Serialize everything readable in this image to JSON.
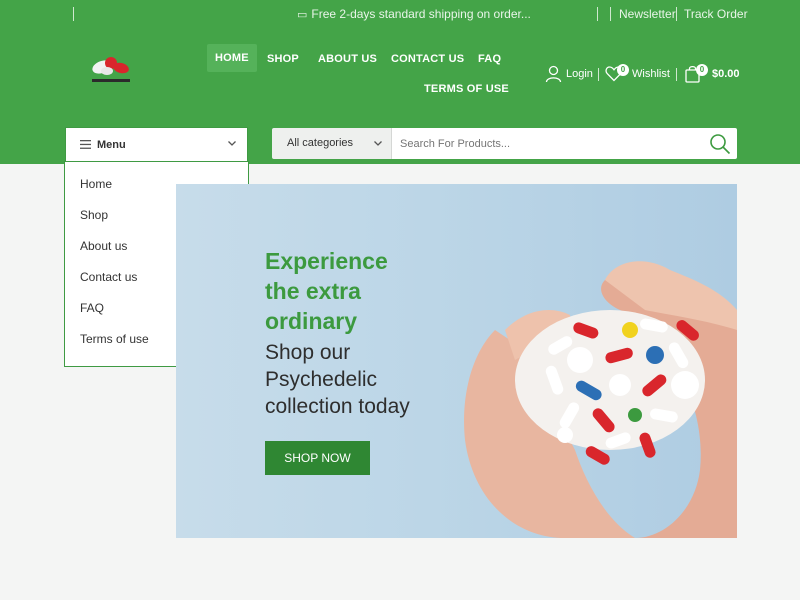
{
  "topbar": {
    "shipping_text": "Free 2-days standard shipping on order...",
    "newsletter": "Newsletter",
    "track_order": "Track Order"
  },
  "nav": {
    "home": "HOME",
    "shop": "SHOP",
    "about": "ABOUT US",
    "contact": "CONTACT US",
    "faq": "FAQ",
    "terms": "TERMS OF USE"
  },
  "header": {
    "login": "Login",
    "wishlist": "Wishlist",
    "wishlist_count": "0",
    "cart_count": "0",
    "cart_total": "$0.00",
    "logo_text": "Psychedelic"
  },
  "menu": {
    "label": "Menu",
    "items": [
      "Home",
      "Shop",
      "About us",
      "Contact us",
      "FAQ",
      "Terms of use"
    ]
  },
  "search": {
    "category": "All categories",
    "placeholder": "Search For Products..."
  },
  "hero": {
    "heading_line1": "Experience",
    "heading_line2": "the extra",
    "heading_line3": "ordinary",
    "sub_line1": "Shop our",
    "sub_line2": "Psychedelic",
    "sub_line3": "collection today",
    "button": "SHOP NOW"
  },
  "colors": {
    "brand_green": "#44a448",
    "dark_green": "#2f8733",
    "heading_green": "#3c9a3f"
  }
}
